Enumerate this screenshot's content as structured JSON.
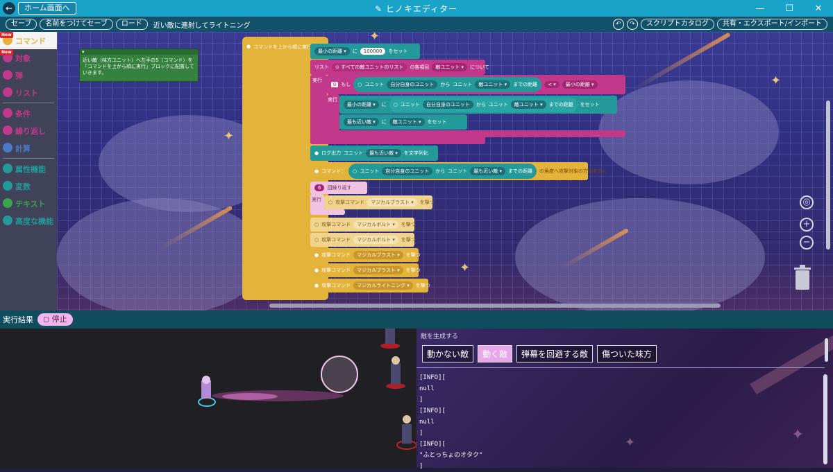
{
  "titlebar": {
    "home_label": "ホーム画面へ",
    "app_title": "ヒノキエディター",
    "window_controls": [
      "—",
      "☐",
      "✕"
    ]
  },
  "toolbar": {
    "save": "セーブ",
    "save_as": "名前をつけてセーブ",
    "load": "ロード",
    "script_name": "近い敵に連射してライトニング",
    "undo": "↶",
    "redo": "↷",
    "catalog": "スクリプトカタログ",
    "share": "共有・エクスポート/インポート"
  },
  "sidebar": {
    "new_badge": "New",
    "items": [
      {
        "label": "コマンド",
        "color": "#e3b33a",
        "new": true
      },
      {
        "label": "対象",
        "color": "#c2398b",
        "new": true
      },
      {
        "label": "弾",
        "color": "#c2398b",
        "new": false
      },
      {
        "label": "リスト",
        "color": "#c2398b",
        "new": false
      },
      {
        "label": "条件",
        "color": "#c2398b",
        "new": false
      },
      {
        "label": "繰り返し",
        "color": "#c2398b",
        "new": false
      },
      {
        "label": "計算",
        "color": "#4a78c2",
        "new": false
      },
      {
        "label": "属性機能",
        "color": "#24999a",
        "new": false
      },
      {
        "label": "変数",
        "color": "#24999a",
        "new": false
      },
      {
        "label": "テキスト",
        "color": "#3aa44c",
        "new": false
      },
      {
        "label": "高度な機能",
        "color": "#24999a",
        "new": false
      }
    ]
  },
  "note": {
    "text": "近い敵（味方ユニット）へ左手の5（コマンド）を「コマンドを上から順に実行」ブロックに配置していきます。"
  },
  "blocks": {
    "main": "コマンドを上から順に実行",
    "set_min": {
      "var": "最小の距離",
      "to": "に",
      "value": "100000",
      "tail": "をセット"
    },
    "list_label": "リスト",
    "list_of": "すべての敵ユニットのリスト",
    "each_label": "の各項目",
    "each_var": "敵ユニット",
    "each_tail": "について",
    "exec_label": "実行",
    "if_label": "もし",
    "unit_word": "ユニット",
    "self_unit": "自分自身のユニット",
    "from_word": "から",
    "enemy_unit": "敵ユニット",
    "distance": "までの距離",
    "lt": "<",
    "min_dist": "最小の距離",
    "set_min_label": "最小の距離",
    "ni": "に",
    "set_tail": "をセット",
    "nearest": "最も近い敵",
    "log_output": "ログ出力",
    "nearest_enemy": "最も近い敵",
    "to_string": "を文字列化",
    "command_label": "コマンド：",
    "dir_tail": "の角度へ攻撃対象の方向を向く",
    "repeat_count": "6",
    "repeat_label": "回繰り返す",
    "attack_cmd": "攻撃コマンド",
    "magic_blast": "マジカルブラスト",
    "magic_bolt": "マジカルボルト",
    "magic_lightning": "マジカルライトニング",
    "fire": "を撃つ"
  },
  "result": {
    "label": "実行結果",
    "stop_label": "停止"
  },
  "console": {
    "heading": "敵を生成する",
    "enemy_buttons": [
      "動かない敵",
      "動く敵",
      "弾幕を回避する敵",
      "傷ついた味方"
    ],
    "selected_index": 1,
    "log_lines": [
      "[INFO][",
      "null",
      "]",
      "[INFO][",
      "null",
      "]",
      "[INFO][",
      "\"ふとっちょのオタク\"",
      "]"
    ]
  },
  "colors": {
    "titlebar": "#1aa3c8",
    "toolbar": "#13516a",
    "command_yellow": "#e3b33a",
    "teal": "#24999a",
    "magenta": "#c2398b"
  }
}
